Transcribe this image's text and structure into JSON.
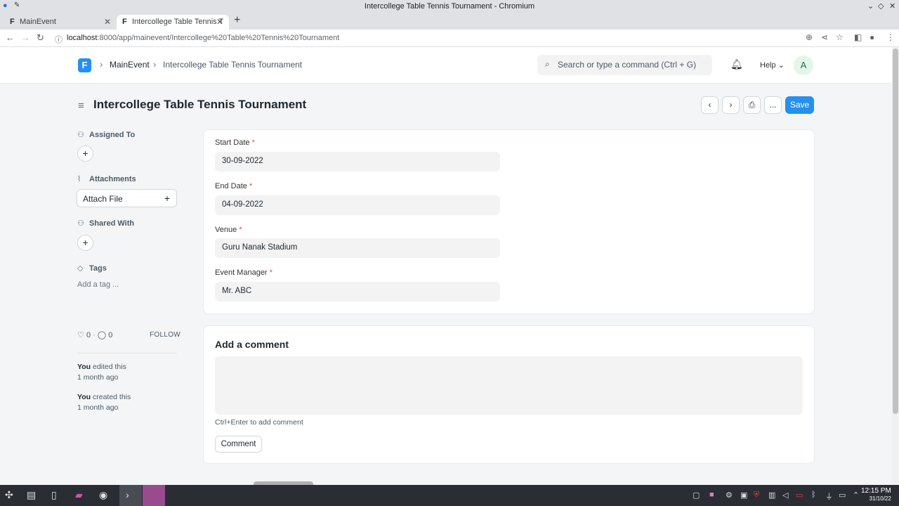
{
  "window": {
    "title": "Intercollege Table Tennis Tournament - Chromium",
    "controls": [
      "⌄",
      "◇",
      "✕"
    ]
  },
  "tabs": [
    {
      "label": "MainEvent",
      "favicon": "F",
      "active": false
    },
    {
      "label": "Intercollege Table Tennis T",
      "favicon": "F",
      "active": true
    }
  ],
  "browser": {
    "url_host": "localhost",
    "url_path": ":8000/app/mainevent/Intercollege%20Table%20Tennis%20Tournament"
  },
  "navbar": {
    "logo": "F",
    "breadcrumbs": [
      "MainEvent",
      "Intercollege Table Tennis Tournament"
    ],
    "search_placeholder": "Search or type a command (Ctrl + G)",
    "help_label": "Help",
    "avatar_initial": "A"
  },
  "page": {
    "title": "Intercollege Table Tennis Tournament",
    "save_label": "Save",
    "more_label": "..."
  },
  "sidebar": {
    "assigned_to": "Assigned To",
    "attachments": "Attachments",
    "attach_file": "Attach File",
    "shared_with": "Shared With",
    "tags": "Tags",
    "add_tag": "Add a tag ...",
    "likes": "0",
    "comments": "0",
    "follow": "FOLLOW",
    "activity": [
      {
        "actor": "You",
        "action": " edited this",
        "time": "1 month ago"
      },
      {
        "actor": "You",
        "action": " created this",
        "time": "1 month ago"
      }
    ]
  },
  "form": {
    "fields": [
      {
        "label": "Start Date",
        "value": "30-09-2022"
      },
      {
        "label": "End Date",
        "value": "04-09-2022"
      },
      {
        "label": "Venue",
        "value": "Guru Nanak Stadium"
      },
      {
        "label": "Event Manager",
        "value": "Mr. ABC"
      }
    ]
  },
  "comments": {
    "title": "Add a comment",
    "hint": "Ctrl+Enter to add comment",
    "button": "Comment"
  },
  "taskbar": {
    "time": "12:15 PM",
    "date": "31/10/22"
  },
  "colors": {
    "primary": "#2490ef",
    "required": "#e24c4c",
    "background": "#f4f5f6"
  }
}
